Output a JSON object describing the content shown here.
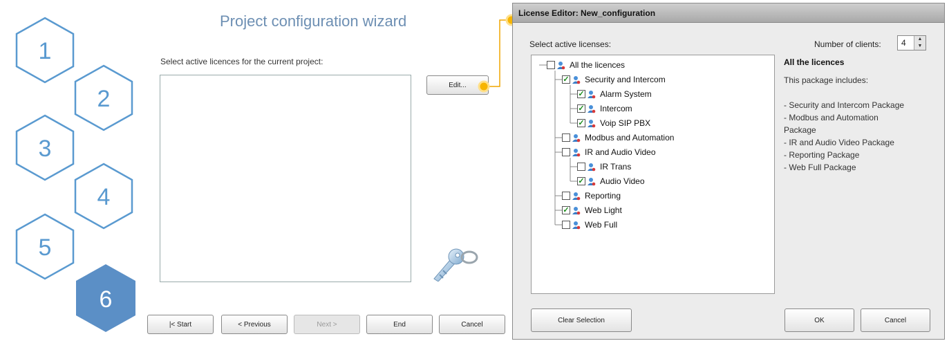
{
  "wizard": {
    "title": "Project configuration wizard",
    "steps": [
      "1",
      "2",
      "3",
      "4",
      "5",
      "6"
    ],
    "active_step": "6",
    "prompt": "Select active licences for the current project:",
    "edit_button": "Edit...",
    "buttons": {
      "start": "|< Start",
      "previous": "< Previous",
      "next": "Next >",
      "end": "End",
      "cancel": "Cancel"
    },
    "colors": {
      "hex_outline": "#5a9ad0",
      "hex_active": "#5b8fc6",
      "title": "#6d8fb3",
      "connector": "#f0a500"
    }
  },
  "editor": {
    "title": "License Editor: New_configuration",
    "select_label": "Select active licenses:",
    "clients_label": "Number of clients:",
    "clients_value": "4",
    "tree": [
      {
        "label": "All the licences",
        "checked": false,
        "level": 0
      },
      {
        "label": "Security and Intercom",
        "checked": true,
        "level": 1
      },
      {
        "label": "Alarm System",
        "checked": true,
        "level": 2
      },
      {
        "label": "Intercom",
        "checked": true,
        "level": 2
      },
      {
        "label": "Voip SIP PBX",
        "checked": true,
        "level": 2
      },
      {
        "label": "Modbus and Automation",
        "checked": false,
        "level": 1
      },
      {
        "label": "IR and Audio Video",
        "checked": false,
        "level": 1
      },
      {
        "label": "IR Trans",
        "checked": false,
        "level": 2
      },
      {
        "label": "Audio Video",
        "checked": true,
        "level": 2
      },
      {
        "label": "Reporting",
        "checked": false,
        "level": 1
      },
      {
        "label": "Web Light",
        "checked": true,
        "level": 1
      },
      {
        "label": "Web Full",
        "checked": false,
        "level": 1
      }
    ],
    "info": {
      "title": "All the licences",
      "subtitle": "This package includes:",
      "lines": [
        "- Security and Intercom Package",
        "- Modbus and Automation",
        "Package",
        "- IR and Audio Video Package",
        "- Reporting Package",
        "- Web Full Package"
      ]
    },
    "buttons": {
      "clear": "Clear Selection",
      "ok": "OK",
      "cancel": "Cancel"
    }
  }
}
